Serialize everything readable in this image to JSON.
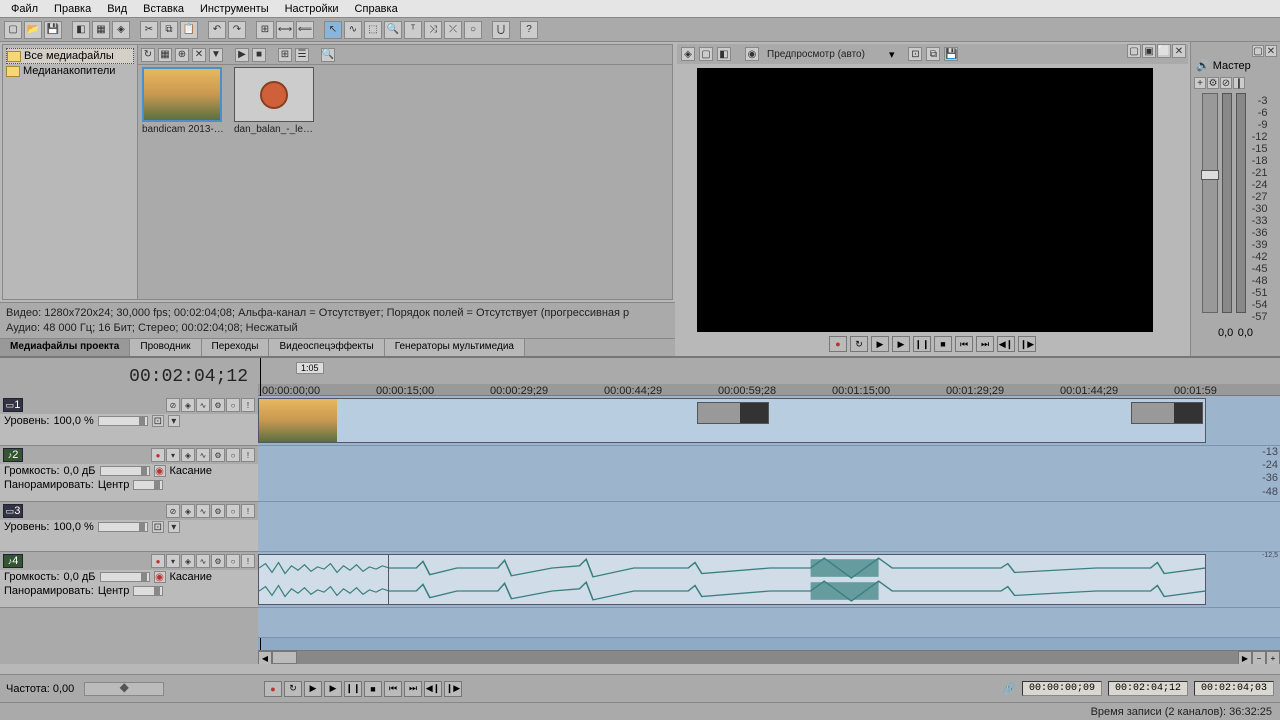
{
  "menu": [
    "Файл",
    "Правка",
    "Вид",
    "Вставка",
    "Инструменты",
    "Настройки",
    "Справка"
  ],
  "media": {
    "tree": {
      "all": "Все медиафайлы",
      "storage": "Медианакопители"
    },
    "items": [
      {
        "name": "bandicam 2013-08..."
      },
      {
        "name": "dan_balan_-_len..."
      }
    ],
    "info1": "Видео: 1280x720x24; 30,000 fps; 00:02:04;08; Альфа-канал = Отсутствует; Порядок полей = Отсутствует (прогрессивная р",
    "info2": "Аудио: 48 000 Гц; 16 Бит; Стерео; 00:02:04;08; Несжатый",
    "tabs": [
      "Медиафайлы проекта",
      "Проводник",
      "Переходы",
      "Видеоспецэффекты",
      "Генераторы мультимедиа"
    ]
  },
  "preview": {
    "mode": "Предпросмотр (авто)"
  },
  "mixer": {
    "title": "Мастер",
    "scale": [
      "-3",
      "-6",
      "-9",
      "-12",
      "-15",
      "-18",
      "-21",
      "-24",
      "-27",
      "-30",
      "-33",
      "-36",
      "-39",
      "-42",
      "-45",
      "-48",
      "-51",
      "-54",
      "-57"
    ],
    "val": "0,0"
  },
  "timecode": "00:02:04;12",
  "marker": "1:05",
  "ruler": [
    "00:00:00;00",
    "00:00:15;00",
    "00:00:29;29",
    "00:00:44;29",
    "00:00:59;28",
    "00:01:15;00",
    "00:01:29;29",
    "00:01:44;29",
    "00:01:59"
  ],
  "tracks": {
    "t1": {
      "num": "1",
      "level_lbl": "Уровень:",
      "level": "100,0 %"
    },
    "t2": {
      "num": "2",
      "vol_lbl": "Громкость:",
      "vol": "0,0 дБ",
      "pan_lbl": "Панорамировать:",
      "pan": "Центр",
      "touch": "Касание"
    },
    "t3": {
      "num": "3",
      "level_lbl": "Уровень:",
      "level": "100,0 %"
    },
    "t4": {
      "num": "4",
      "vol_lbl": "Громкость:",
      "vol": "0,0 дБ",
      "pan_lbl": "Панорамировать:",
      "pan": "Центр",
      "touch": "Касание"
    }
  },
  "audio_scale": [
    "-12,5",
    "-13",
    "-24",
    "-36",
    "-48"
  ],
  "rate": {
    "lbl": "Частота: 0,00"
  },
  "tc_boxes": [
    "00:00:00;09",
    "00:02:04;12",
    "00:02:04;03"
  ],
  "status": "Время записи (2 каналов): 36:32:25"
}
